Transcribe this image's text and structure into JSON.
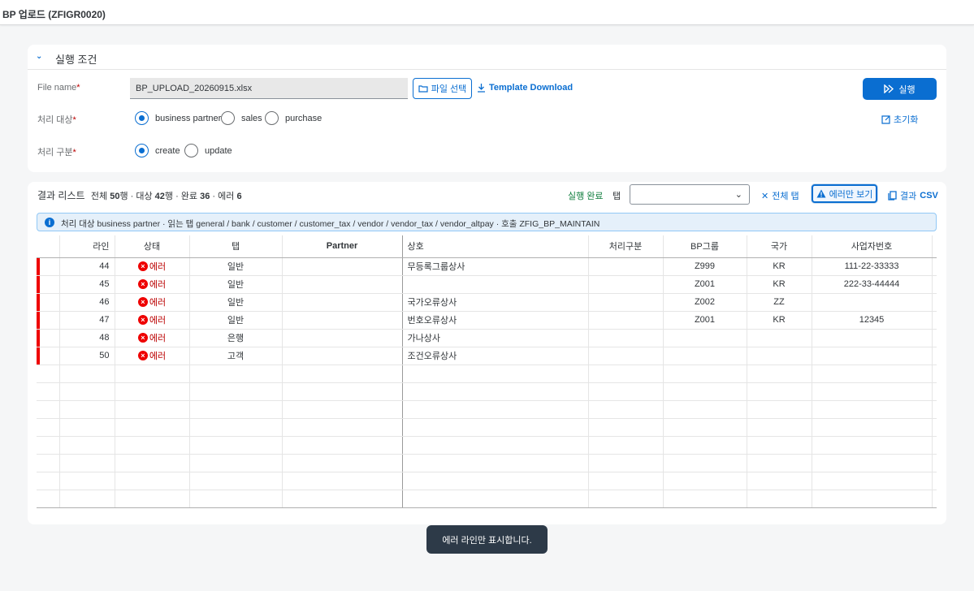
{
  "page_title": "BP 업로드 (ZFIGR0020)",
  "conditions": {
    "title": "실행 조건",
    "file_name_label": "File name",
    "file_name_value": "BP_UPLOAD_20260915.xlsx",
    "file_select_label": "파일 선택",
    "template_download_label": "Template Download",
    "run_label": "실행",
    "reset_label": "초기화",
    "target_label": "처리 대상",
    "target_options": [
      "business partner",
      "sales",
      "purchase"
    ],
    "target_selected": "business partner",
    "mode_label": "처리 구분",
    "mode_options": [
      "create",
      "update"
    ],
    "mode_selected": "create"
  },
  "results": {
    "title": "결과 리스트",
    "summary": {
      "total_prefix": "전체",
      "total": "50",
      "total_unit": "행 · 대상",
      "target": "42",
      "target_unit": "행 · 완료",
      "done": "36",
      "done_unit": "· 에러",
      "error": "6"
    },
    "done_label": "실행 완료",
    "tab_label": "탭",
    "tab_select_value": "",
    "all_tabs_label": "전체 탭",
    "error_only_label": "에러만 보기",
    "csv_label_prefix": "결과",
    "csv_label": "CSV",
    "info_text": "처리 대상 business partner · 읽는 탭 general / bank / customer / customer_tax / vendor / vendor_tax / vendor_altpay · 호출 ZFIG_BP_MAINTAIN",
    "columns": [
      "라인",
      "상태",
      "탭",
      "Partner",
      "상호",
      "처리구분",
      "BP그룹",
      "국가",
      "사업자번호"
    ],
    "rows": [
      {
        "line": "44",
        "status": "에러",
        "tab": "일반",
        "partner": "",
        "name": "무등록그룹상사",
        "mode": "",
        "group": "Z999",
        "country": "KR",
        "bizno": "111-22-33333"
      },
      {
        "line": "45",
        "status": "에러",
        "tab": "일반",
        "partner": "",
        "name": "",
        "mode": "",
        "group": "Z001",
        "country": "KR",
        "bizno": "222-33-44444"
      },
      {
        "line": "46",
        "status": "에러",
        "tab": "일반",
        "partner": "",
        "name": "국가오류상사",
        "mode": "",
        "group": "Z002",
        "country": "ZZ",
        "bizno": ""
      },
      {
        "line": "47",
        "status": "에러",
        "tab": "일반",
        "partner": "",
        "name": "번호오류상사",
        "mode": "",
        "group": "Z001",
        "country": "KR",
        "bizno": "12345"
      },
      {
        "line": "48",
        "status": "에러",
        "tab": "은행",
        "partner": "",
        "name": "가나상사",
        "mode": "",
        "group": "",
        "country": "",
        "bizno": ""
      },
      {
        "line": "50",
        "status": "에러",
        "tab": "고객",
        "partner": "",
        "name": "조건오류상사",
        "mode": "",
        "group": "",
        "country": "",
        "bizno": ""
      }
    ],
    "empty_rows": 8
  },
  "toast": "에러 라인만 표시합니다.",
  "colors": {
    "accent": "#0a6ed1",
    "error": "#ee0000",
    "success": "#107e3e",
    "toast_bg": "#2d3a48"
  }
}
